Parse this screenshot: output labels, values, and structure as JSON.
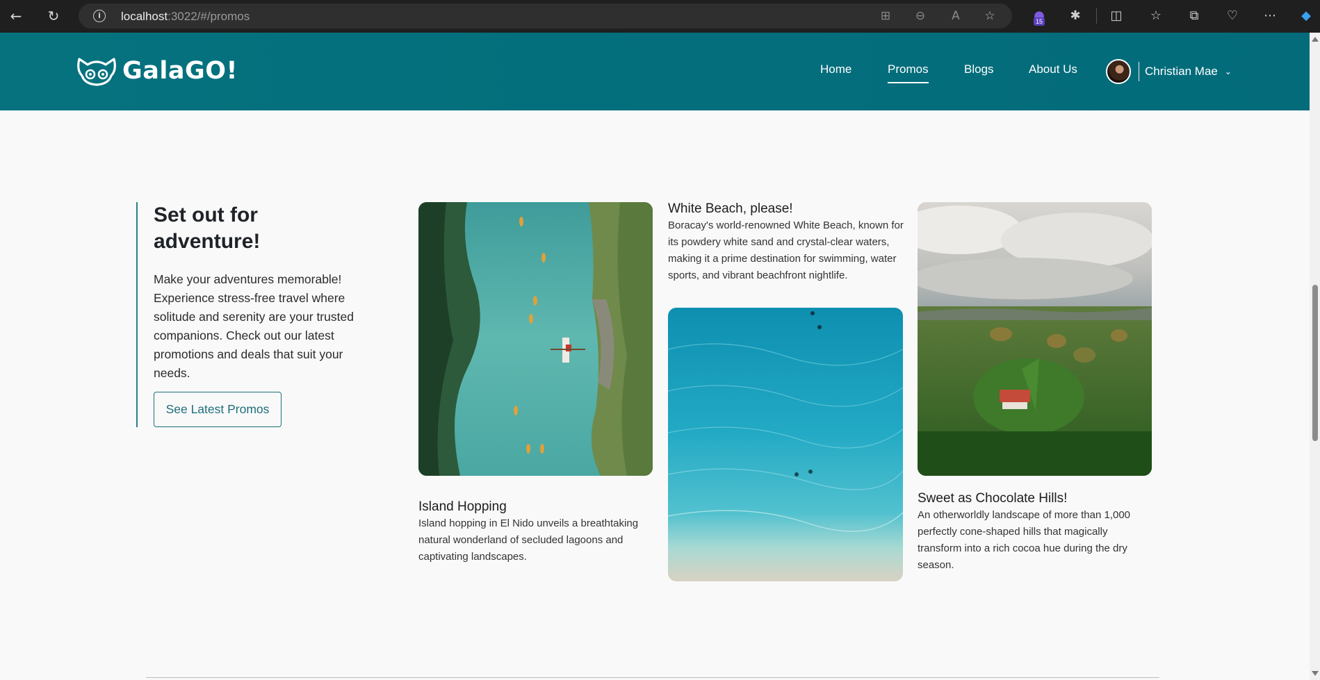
{
  "browser": {
    "url_host": "localhost",
    "url_path": ":3022/#/promos",
    "extension_badge": "15"
  },
  "site": {
    "brand": "GalaGO!",
    "nav": [
      {
        "label": "Home"
      },
      {
        "label": "Promos"
      },
      {
        "label": "Blogs"
      },
      {
        "label": "About Us"
      }
    ],
    "user_name": "Christian Mae"
  },
  "intro": {
    "heading": "Set out for adventure!",
    "body": "Make your adventures memorable! Experience stress-free travel where solitude and serenity are your trusted companions. Check out our latest promotions and deals that suit your needs.",
    "button_label": "See Latest Promos"
  },
  "cards": [
    {
      "title": "Island Hopping",
      "description": "Island hopping in El Nido unveils a breathtaking natural wonderland of secluded lagoons and captivating landscapes."
    },
    {
      "title": "White Beach, please!",
      "description": "Boracay's world-renowned White Beach, known for its powdery white sand and crystal-clear waters, making it a prime destination for swimming, water sports, and vibrant beachfront nightlife."
    },
    {
      "title": "Sweet as Chocolate Hills!",
      "description": "An otherworldly landscape of more than 1,000 perfectly cone-shaped hills that magically transform into a rich cocoa hue during the dry season."
    }
  ],
  "colors": {
    "header_teal": "#05727e",
    "accent": "#1e6f7b",
    "page_bg": "#f9f9f9"
  }
}
